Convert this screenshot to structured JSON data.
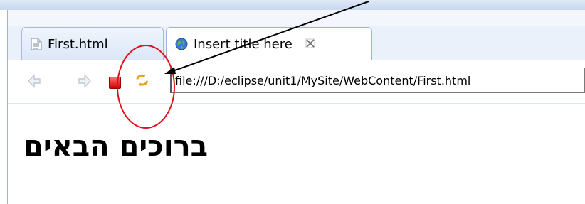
{
  "tabs": [
    {
      "label": "First.html",
      "icon": "html-file-icon",
      "active": false
    },
    {
      "label": "Insert title here",
      "icon": "globe-icon",
      "active": true,
      "close_icon": "close-icon"
    }
  ],
  "toolbar": {
    "back_icon": "back-arrow-icon",
    "forward_icon": "forward-arrow-icon",
    "stop_icon": "stop-icon",
    "refresh_icon": "refresh-icon",
    "url": "file:///D:/eclipse/unit1/MySite/WebContent/First.html"
  },
  "page": {
    "heading": "ברוכים הבאים"
  },
  "annotation": {
    "type": "callout-arrow-and-circle",
    "target": "refresh-icon",
    "color": "#e0101a"
  }
}
